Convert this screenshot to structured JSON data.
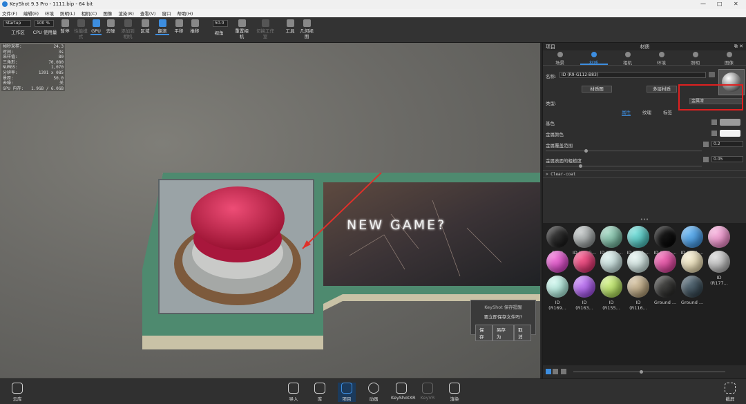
{
  "window": {
    "title": "KeyShot 9.3 Pro - 1111.bip - 64 bit",
    "min": "—",
    "max": "□",
    "close": "✕"
  },
  "menu": [
    "文件(F)",
    "编辑(E)",
    "环境",
    "照明(L)",
    "相机(C)",
    "图像",
    "渲染(R)",
    "查看(V)",
    "窗口",
    "帮助(H)"
  ],
  "toolbar": {
    "workspace_select": "Startup",
    "zoom_select": "100 %",
    "items": [
      {
        "label": "工作区"
      },
      {
        "label": "CPU 使用量"
      },
      {
        "label": "暂停"
      },
      {
        "label": "性能模式"
      },
      {
        "label": "GPU"
      },
      {
        "label": "去噪"
      },
      {
        "label": "添加到相机"
      },
      {
        "label": "区域"
      },
      {
        "label": "翻滚"
      },
      {
        "label": "平移"
      },
      {
        "label": "推移"
      },
      {
        "label": "视角"
      },
      {
        "label": "重置相机"
      },
      {
        "label": "切换工作室"
      },
      {
        "label": "工具"
      },
      {
        "label": "几何视图"
      }
    ],
    "fov_value": "50.0"
  },
  "stats": [
    [
      "帧秒采样:",
      "24.3"
    ],
    [
      "时间:",
      "3s"
    ],
    [
      "采样值:",
      "80"
    ],
    [
      "三角形:",
      "70,080"
    ],
    [
      "NURBS:",
      "1,070"
    ],
    [
      "分辨率:",
      "1391 x 085"
    ],
    [
      "景距:",
      "50.0"
    ],
    [
      "去噪:",
      "关"
    ],
    [
      "GPU 内存:",
      "1.9GB / 6.0GB"
    ]
  ],
  "scene": {
    "sign_text": "NEW GAME?"
  },
  "dialog": {
    "title": "KeyShot 保存提醒",
    "question": "要立即保存文件吗?",
    "save": "保存",
    "save_as": "另存为",
    "cancel": "取消"
  },
  "panel": {
    "left_title": "项目",
    "center_title": "材质",
    "tabs": [
      "场景",
      "材质",
      "相机",
      "环境",
      "照明",
      "图像"
    ],
    "name_label": "名称:",
    "name_value": "ID (R9-G112-B83)",
    "graph_btn": "材质图",
    "multi_btn": "多层材质",
    "type_label": "类型:",
    "type_value": "金属漆",
    "subtabs": [
      "属性",
      "纹理",
      "标签"
    ],
    "props": [
      {
        "label": "基色",
        "color": "#9a9a9a"
      },
      {
        "label": "金属颜色",
        "color": "#f2f2f2"
      },
      {
        "label": "金属覆盖范围",
        "value": "0.2"
      },
      {
        "label": "金属表面的粗糙度",
        "value": "0.05"
      }
    ],
    "clearcoat": "> Clear-coat"
  },
  "library": {
    "dots": "•••",
    "materials": [
      {
        "name": "Paint Glo...",
        "c1": "#3a3a3a",
        "c2": "#0d0d0d"
      },
      {
        "name": "ID (R9-G...",
        "c1": "#c7cbcb",
        "c2": "#6f7474"
      },
      {
        "name": "ID (R85-...",
        "c1": "#a6d8c4",
        "c2": "#4f8f78"
      },
      {
        "name": "ID (R47-...",
        "c1": "#7ee0dc",
        "c2": "#2f9d98"
      },
      {
        "name": "ID (R31-...",
        "c1": "#1a1a1a",
        "c2": "#000000"
      },
      {
        "name": "ID (R30-...",
        "c1": "#6bb6f0",
        "c2": "#2b78c0"
      },
      {
        "name": "ID (R243...",
        "c1": "#f6b6de",
        "c2": "#d06aa8"
      },
      {
        "name": "ID (R222...",
        "c1": "#ef7bd8",
        "c2": "#b62aa8"
      },
      {
        "name": "ID (R218...",
        "c1": "#f46090",
        "c2": "#b81e55"
      },
      {
        "name": "ID (R214...",
        "c1": "#dff0ee",
        "c2": "#9fb9b6"
      },
      {
        "name": "ID (R203...",
        "c1": "#e9f4f1",
        "c2": "#a8c0bc"
      },
      {
        "name": "ID (R199...",
        "c1": "#f071b8",
        "c2": "#b82a7d"
      },
      {
        "name": "ID (R197...",
        "c1": "#f6efd6",
        "c2": "#c8b98c"
      },
      {
        "name": "ID (R177...",
        "c1": "#dcdcdc",
        "c2": "#8c8c8c"
      },
      {
        "name": "ID (R169...",
        "c1": "#d5f7ef",
        "c2": "#86c9b9"
      },
      {
        "name": "ID (R163...",
        "c1": "#c88af4",
        "c2": "#8133c8"
      },
      {
        "name": "ID (R155...",
        "c1": "#d3f08e",
        "c2": "#8ab83a"
      },
      {
        "name": "ID (R116...",
        "c1": "#d7c6a8",
        "c2": "#8f7b56"
      },
      {
        "name": "Ground ...",
        "c1": "#4a4a48",
        "c2": "#1d1d1c"
      },
      {
        "name": "Ground ...",
        "c1": "#5b6e7a",
        "c2": "#22313a"
      }
    ]
  },
  "bottom": [
    {
      "label": "云库"
    },
    {
      "label": "导入"
    },
    {
      "label": "库"
    },
    {
      "label": "项目"
    },
    {
      "label": "动画"
    },
    {
      "label": "KeyShotXR"
    },
    {
      "label": "KeyVR"
    },
    {
      "label": "渲染"
    },
    {
      "label": "截屏"
    }
  ],
  "colors": {
    "accent": "#3d8ee0",
    "highlight_box": "#e02020",
    "button_red": "#d5204a"
  }
}
